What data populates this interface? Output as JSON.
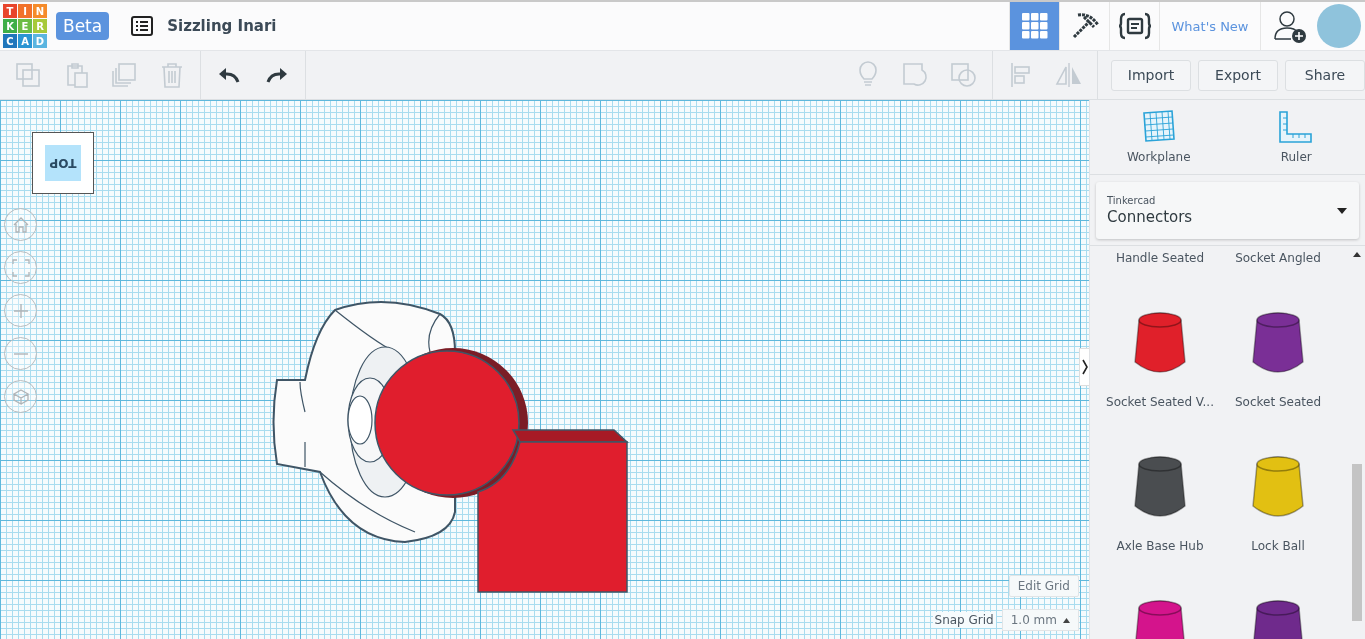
{
  "header": {
    "logo": [
      {
        "letter": "T",
        "color": "#e8452c"
      },
      {
        "letter": "I",
        "color": "#f1712a"
      },
      {
        "letter": "N",
        "color": "#f58b2b"
      },
      {
        "letter": "K",
        "color": "#3fae49"
      },
      {
        "letter": "E",
        "color": "#6cbd45"
      },
      {
        "letter": "R",
        "color": "#a7c93a"
      },
      {
        "letter": "C",
        "color": "#1f76bc"
      },
      {
        "letter": "A",
        "color": "#2a95d3"
      },
      {
        "letter": "D",
        "color": "#5bb5e0"
      }
    ],
    "badge": "Beta",
    "project_title": "Sizzling Inari",
    "nav": [
      {
        "kind": "grid",
        "selected": true
      },
      {
        "kind": "pickaxe",
        "selected": false
      },
      {
        "kind": "code",
        "selected": false
      }
    ],
    "whats_new": "What's New"
  },
  "toolbar": {
    "edit_tools": [
      {
        "kind": "copy",
        "disabled": true
      },
      {
        "kind": "paste",
        "disabled": true
      },
      {
        "kind": "duplicate",
        "disabled": true
      },
      {
        "kind": "delete",
        "disabled": true
      }
    ],
    "history": [
      {
        "kind": "undo",
        "disabled": false
      },
      {
        "kind": "redo",
        "disabled": false
      }
    ],
    "shape_tools": [
      {
        "kind": "bulb",
        "disabled": true
      },
      {
        "kind": "group",
        "disabled": true
      },
      {
        "kind": "ungroup",
        "disabled": true
      }
    ],
    "layout_tools": [
      {
        "kind": "align",
        "disabled": true
      },
      {
        "kind": "mirror",
        "disabled": true
      }
    ],
    "buttons": [
      "Import",
      "Export",
      "Share"
    ]
  },
  "canvas": {
    "view_cube": "TOP",
    "view_controls": [
      {
        "kind": "home"
      },
      {
        "kind": "fit"
      },
      {
        "kind": "zoom-in"
      },
      {
        "kind": "zoom-out"
      },
      {
        "kind": "perspective"
      }
    ],
    "edit_grid": "Edit Grid",
    "snap_grid_label": "Snap Grid",
    "snap_grid_value": "1.0 mm"
  },
  "panel": {
    "tools": [
      {
        "kind": "workplane",
        "label": "Workplane"
      },
      {
        "kind": "ruler",
        "label": "Ruler"
      }
    ],
    "library": {
      "source": "Tinkercad",
      "category": "Connectors"
    },
    "shapes": [
      {
        "label": "Handle Seated"
      },
      {
        "label": "Socket Angled"
      },
      {
        "label": "Socket Seated V...",
        "color": "#e0202a"
      },
      {
        "label": "Socket Seated",
        "color": "#7a2f96"
      },
      {
        "label": "Axle Base Hub",
        "color": "#4a4d50"
      },
      {
        "label": "Lock Ball",
        "color": "#e2c012"
      },
      {
        "color": "#d4148c"
      },
      {
        "color": "#6f2a8c"
      }
    ]
  }
}
